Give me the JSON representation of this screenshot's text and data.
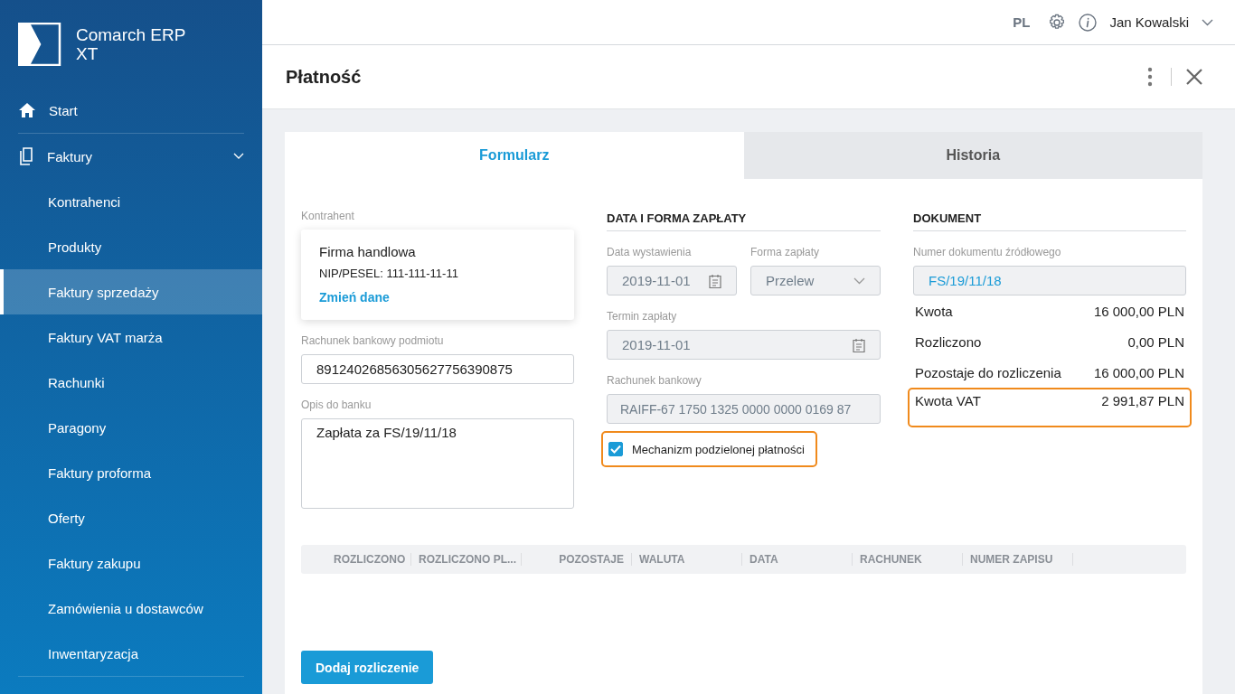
{
  "sidebar": {
    "logo_lines": [
      "Comarch ERP",
      "XT"
    ],
    "items": [
      {
        "kind": "link",
        "label": "Start",
        "selected": false
      },
      {
        "kind": "group",
        "label": "Faktury",
        "expanded": true,
        "selected": false,
        "children": [
          {
            "label": "Kontrahenci",
            "selected": false
          },
          {
            "label": "Produkty",
            "selected": false
          },
          {
            "label": "Faktury sprzedaży",
            "selected": true
          },
          {
            "label": "Faktury VAT marża",
            "selected": false
          },
          {
            "label": "Rachunki",
            "selected": false
          },
          {
            "label": "Paragony",
            "selected": false
          },
          {
            "label": "Faktury proforma",
            "selected": false
          },
          {
            "label": "Oferty",
            "selected": false
          },
          {
            "label": "Faktury zakupu",
            "selected": false
          },
          {
            "label": "Zamówienia u dostawców",
            "selected": false
          },
          {
            "label": "Inwentaryzacja",
            "selected": false
          }
        ]
      }
    ]
  },
  "topbar": {
    "language": "PL",
    "user": "Jan Kowalski"
  },
  "page": {
    "title": "Płatność"
  },
  "tabs": [
    {
      "label": "Formularz",
      "selected": true
    },
    {
      "label": "Historia",
      "selected": false
    }
  ],
  "contractor": {
    "label": "Kontrahent",
    "name": "Firma handlowa",
    "tax_id": "NIP/PESEL: 111-111-11-11",
    "link": "Zmień dane"
  },
  "bank_account_field": {
    "label": "Rachunek bankowy podmiotu",
    "value": "89124026856305627756390875"
  },
  "bank_description_field": {
    "label": "Opis do banku",
    "value": "Zapłata za FS/19/11/18"
  },
  "payment": {
    "heading": "DATA I FORMA ZAPŁATY",
    "issue_date": {
      "label": "Data wystawienia",
      "value": "2019-11-01"
    },
    "payment_form": {
      "label": "Forma zapłaty",
      "value": "Przelew"
    },
    "due_date": {
      "label": "Termin zapłaty",
      "value": "2019-11-01"
    },
    "bank_account": {
      "label": "Rachunek bankowy",
      "value": "RAIFF-67 1750 1325 0000 0000 0169 87"
    },
    "split_payment": {
      "label": "Mechanizm podzielonej płatności",
      "checked": true,
      "highlighted": true
    }
  },
  "document": {
    "heading": "DOKUMENT",
    "source_label": "Numer dokumentu źródłowego",
    "source_value": "FS/19/11/18",
    "amounts": [
      {
        "label": "Kwota",
        "value": "16 000,00 PLN",
        "highlighted": false
      },
      {
        "label": "Rozliczono",
        "value": "0,00 PLN",
        "highlighted": false
      },
      {
        "label": "Pozostaje do rozliczenia",
        "value": "16 000,00 PLN",
        "highlighted": false
      },
      {
        "label": "Kwota VAT",
        "value": "2 991,87 PLN",
        "highlighted": true
      }
    ]
  },
  "table": {
    "columns": [
      "ROZLICZONO",
      "ROZLICZONO PL...",
      "POZOSTAJE",
      "WALUTA",
      "DATA",
      "RACHUNEK",
      "NUMER ZAPISU"
    ]
  },
  "add_button": "Dodaj rozliczenie"
}
